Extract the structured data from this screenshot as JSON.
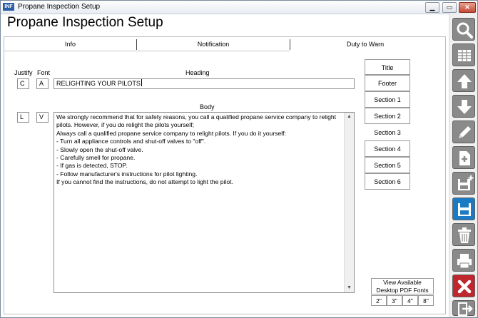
{
  "window": {
    "title": "Propane Inspection Setup",
    "app_icon_text": "INF"
  },
  "page_title": "Propane Inspection Setup",
  "tabs": [
    {
      "label": "Info"
    },
    {
      "label": "Notification"
    },
    {
      "label": "Duty to Warn"
    }
  ],
  "labels": {
    "justify": "Justify",
    "font": "Font",
    "heading": "Heading",
    "body": "Body"
  },
  "heading_row": {
    "justify": "C",
    "font": "A",
    "heading": "RELIGHTING YOUR PILOTS"
  },
  "body_row": {
    "justify": "L",
    "font": "V",
    "lines": [
      "We strongly recommend that for safety reasons, you call a qualified propane service company to relight",
      "pilots. However, if you do relight the pilots yourself;",
      "Always call a qualified propane service company to relight pilots. If you do it yourself:",
      " - Turn all appliance controls and shut-off valves to \"off\".",
      " - Slowly open the shut-off valve.",
      " - Carefully smell for propane.",
      " - If gas is detected, STOP.",
      " - Follow manufacturer's instructions for pilot lighting.",
      "If you cannot find the instructions, do not attempt to light the pilot."
    ]
  },
  "section_tabs": [
    "Title",
    "Footer",
    "Section 1",
    "Section 2",
    "Section 3",
    "Section 4",
    "Section 5",
    "Section 6"
  ],
  "active_section": "Section 3",
  "pdf_fonts": {
    "line1": "View Available",
    "line2": "Desktop PDF Fonts",
    "sizes": [
      "2\"",
      "3\"",
      "4\"",
      "8\""
    ]
  },
  "toolbar_icons": [
    "search-icon",
    "grid-icon",
    "arrow-up-icon",
    "arrow-down-icon",
    "pencil-icon",
    "new-document-icon",
    "save-new-icon",
    "save-icon",
    "trash-icon",
    "print-icon",
    "close-icon",
    "exit-icon"
  ],
  "colors": {
    "toolbar_gray": "#8a8a8a",
    "save_blue": "#1a7bc4",
    "close_red": "#c0262e"
  }
}
